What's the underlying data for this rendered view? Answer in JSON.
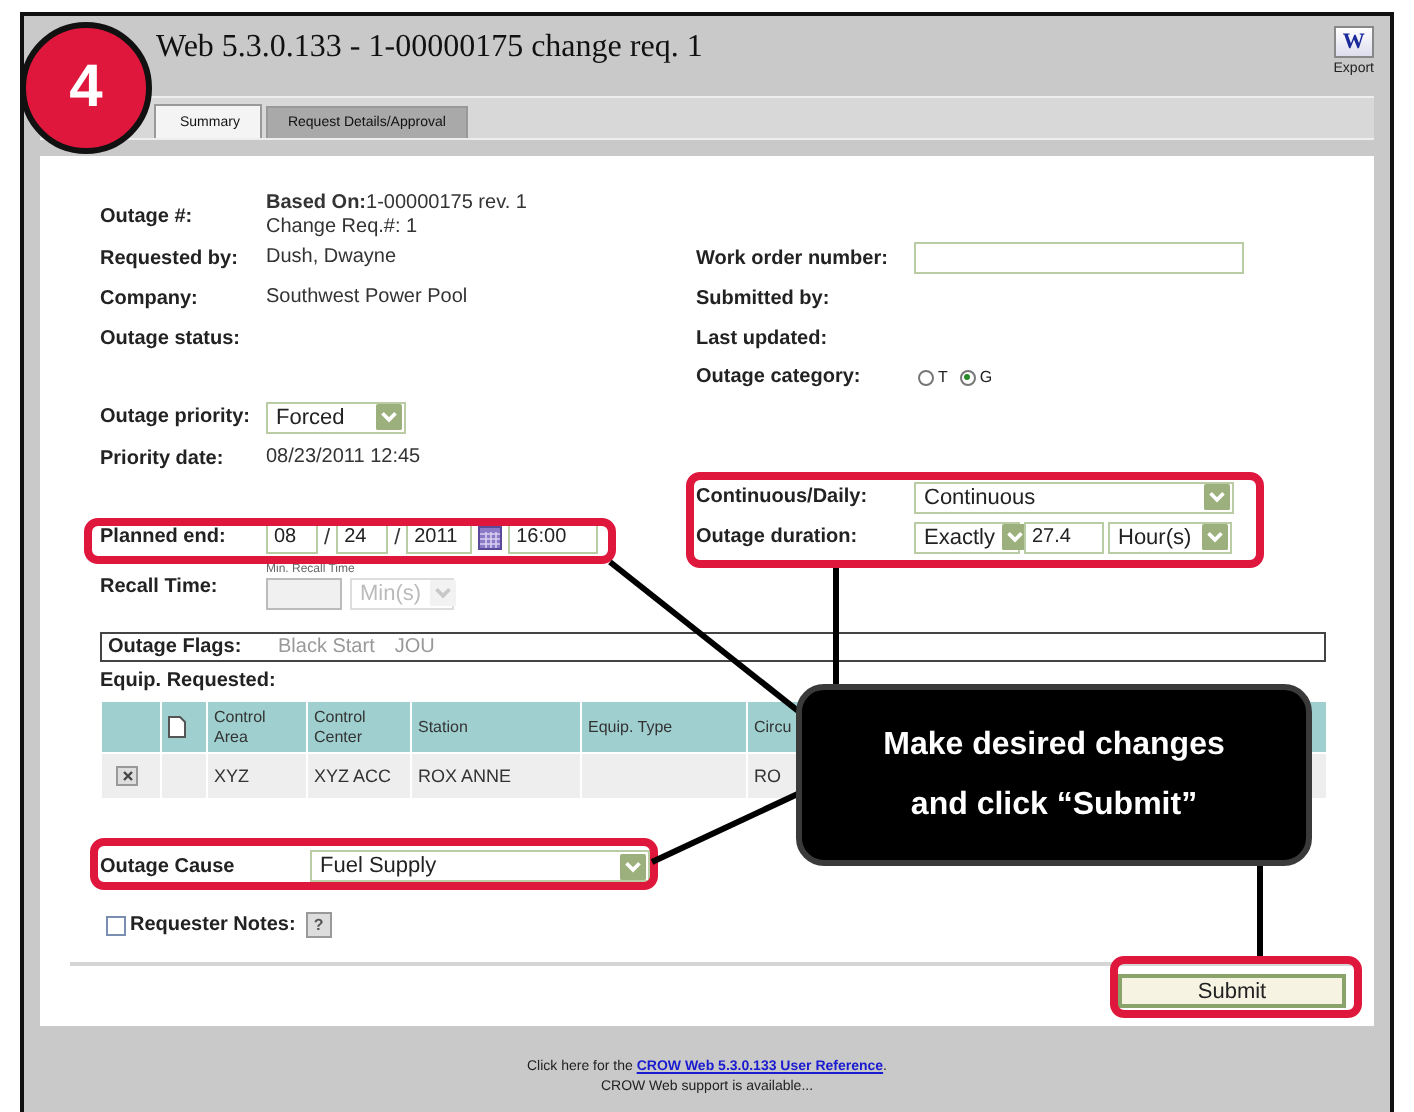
{
  "step_badge": "4",
  "window": {
    "title": "Web 5.3.0.133 - 1-00000175 change req. 1",
    "export": {
      "icon_letter": "W",
      "label": "Export"
    }
  },
  "tabs": [
    {
      "label": "Summary",
      "selected": true
    },
    {
      "label": "Request Details/Approval",
      "selected": false
    }
  ],
  "form_rows": [
    {
      "left": {
        "label": "Outage #:",
        "kind": "text",
        "lines": [
          "**Based On:**1-00000175 rev. 1",
          "Change Req.#: 1"
        ]
      }
    },
    {
      "left": {
        "label": "Requested by:",
        "kind": "text",
        "lines": [
          "Dush, Dwayne"
        ]
      },
      "right": {
        "label": "Work order number:",
        "kind": "input"
      }
    },
    {
      "left": {
        "label": "Company:",
        "kind": "text",
        "lines": [
          "Southwest Power Pool"
        ]
      },
      "right": {
        "label": "Submitted by:",
        "kind": "text"
      }
    },
    {
      "left": {
        "label": "Outage status:",
        "kind": "text"
      },
      "right": {
        "label": "Last updated:",
        "kind": "text"
      }
    },
    {
      "right": {
        "label": "Outage category:",
        "kind": "radio",
        "options": [
          {
            "label": "T",
            "selected": false
          },
          {
            "label": "G",
            "selected": true
          }
        ]
      }
    },
    {
      "left": {
        "label": "Outage priority:",
        "kind": "select",
        "value": "Forced"
      }
    },
    {
      "left": {
        "label": "Priority date:",
        "kind": "text",
        "lines": [
          "08/23/2011 12:45"
        ]
      }
    },
    {
      "right": {
        "label": "Continuous/Daily:",
        "kind": "select",
        "value": "Continuous",
        "highlighted": true
      }
    },
    {
      "left": {
        "label": "Planned end:",
        "kind": "date",
        "month": "08",
        "day": "24",
        "year": "2011",
        "separator": "/",
        "time": "16:00",
        "highlighted": true
      },
      "right": {
        "label": "Outage duration:",
        "kind": "duration",
        "mode": "Exactly",
        "amount": "27.4",
        "unit": "Hour(s)",
        "highlighted": true
      }
    },
    {
      "left": {
        "label": "Recall Time:",
        "kind": "recall",
        "caption": "Min. Recall Time",
        "unit": "Min(s)",
        "disabled": true
      }
    }
  ],
  "outage_flags": {
    "label": "Outage Flags:",
    "items": [
      "Black Start",
      "JOU"
    ]
  },
  "equipment": {
    "title": "Equip. Requested:",
    "columns": [
      {
        "kind": "blank"
      },
      {
        "kind": "document"
      },
      {
        "kind": "text",
        "label": "Control Area"
      },
      {
        "kind": "text",
        "label": "Control Center"
      },
      {
        "kind": "text",
        "label": "Station"
      },
      {
        "kind": "text",
        "label": "Equip. Type"
      },
      {
        "kind": "text",
        "label": "Circu"
      }
    ],
    "rows": [
      [
        {
          "kind": "delete"
        },
        {
          "kind": "empty"
        },
        {
          "kind": "text",
          "text": "XYZ"
        },
        {
          "kind": "text",
          "text": "XYZ ACC"
        },
        {
          "kind": "text",
          "text": "ROX ANNE"
        },
        {
          "kind": "empty"
        },
        {
          "kind": "text",
          "text": "RO"
        }
      ]
    ]
  },
  "outage_cause": {
    "label": "Outage Cause",
    "value": "Fuel Supply",
    "highlighted": true
  },
  "requester_notes": {
    "label": "Requester Notes:",
    "checked": false,
    "help": "?"
  },
  "submit": {
    "label": "Submit",
    "highlighted": true
  },
  "footer": {
    "lead": "Click here for the ",
    "link": "CROW Web 5.3.0.133 User Reference",
    "tail": ".",
    "support": "CROW Web support is available..."
  },
  "callout": {
    "text": "Make desired changes and click “Submit”"
  }
}
